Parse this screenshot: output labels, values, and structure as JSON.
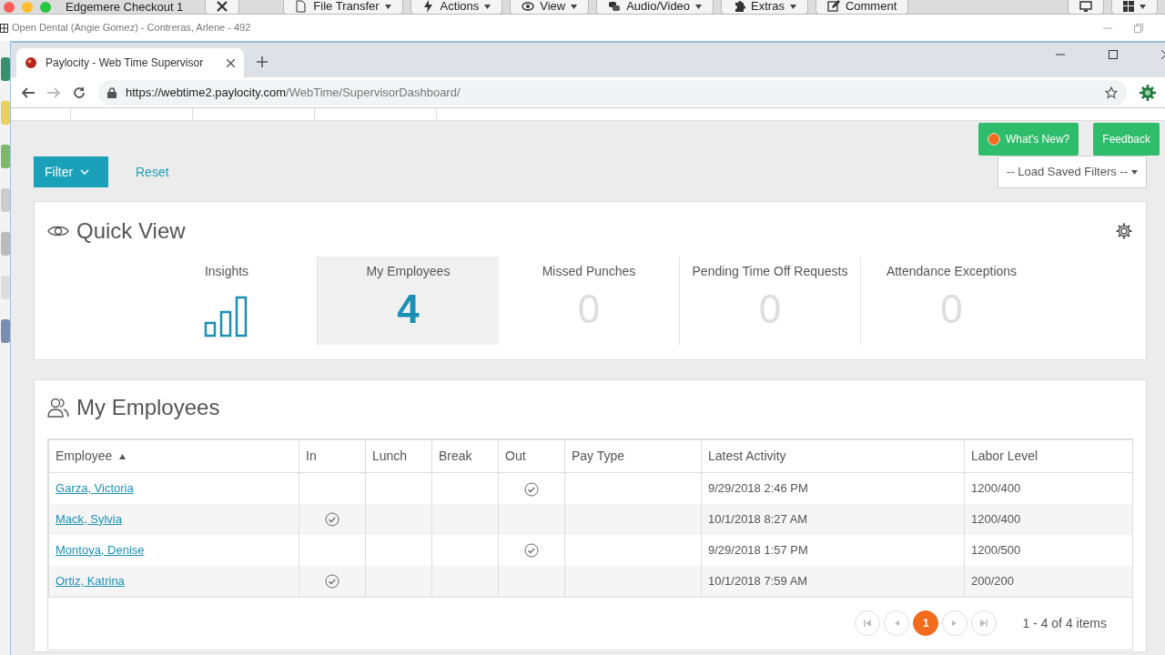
{
  "remote_session": {
    "title": "Edgemere Checkout 1",
    "toolbar": [
      {
        "label": "File Transfer",
        "dropdown": true
      },
      {
        "label": "Actions",
        "dropdown": true
      },
      {
        "label": "View",
        "dropdown": true
      },
      {
        "label": "Audio/Video",
        "dropdown": true
      },
      {
        "label": "Extras",
        "dropdown": true
      },
      {
        "label": "Comment",
        "dropdown": false
      }
    ]
  },
  "host_window": {
    "title": "Open Dental (Angie Gomez) - Contreras, Arlene - 492"
  },
  "browser": {
    "tab_title": "Paylocity - Web Time Supervisor",
    "url_host": "https://webtime2.paylocity.com",
    "url_path": "/WebTime/SupervisorDashboard/"
  },
  "header_buttons": [
    {
      "label": "What's New?",
      "kind": "news"
    },
    {
      "label": "Feedback",
      "kind": "plain"
    }
  ],
  "filter": {
    "button": "Filter",
    "reset": "Reset",
    "saved_filters": "-- Load Saved Filters --"
  },
  "quick_view": {
    "title": "Quick View",
    "tiles": [
      {
        "label": "Insights",
        "kind": "chart",
        "selected": false
      },
      {
        "label": "My Employees",
        "kind": "count",
        "value": "4",
        "selected": true
      },
      {
        "label": "Missed Punches",
        "kind": "count",
        "value": "0",
        "selected": false
      },
      {
        "label": "Pending Time Off Requests",
        "kind": "count",
        "value": "0",
        "selected": false
      },
      {
        "label": "Attendance Exceptions",
        "kind": "count",
        "value": "0",
        "selected": false
      }
    ]
  },
  "employees": {
    "title": "My Employees",
    "columns": [
      {
        "label": "Employee",
        "sorted": true
      },
      {
        "label": "In",
        "sorted": false
      },
      {
        "label": "Lunch",
        "sorted": false
      },
      {
        "label": "Break",
        "sorted": false
      },
      {
        "label": "Out",
        "sorted": false
      },
      {
        "label": "Pay Type",
        "sorted": false
      },
      {
        "label": "Latest Activity",
        "sorted": false
      },
      {
        "label": "Labor Level",
        "sorted": false
      }
    ],
    "rows": [
      {
        "employee": "Garza, Victoria",
        "in": false,
        "out": true,
        "latest_activity": "9/29/2018 2:46 PM",
        "labor_level": "1200/400"
      },
      {
        "employee": "Mack, Sylvia",
        "in": true,
        "out": false,
        "latest_activity": "10/1/2018 8:27 AM",
        "labor_level": "1200/400"
      },
      {
        "employee": "Montoya, Denise",
        "in": false,
        "out": true,
        "latest_activity": "9/29/2018 1:57 PM",
        "labor_level": "1200/500"
      },
      {
        "employee": "Ortiz, Katrina",
        "in": true,
        "out": false,
        "latest_activity": "10/1/2018 7:59 AM",
        "labor_level": "200/200"
      }
    ]
  },
  "pagination": {
    "pages": [
      {
        "label": "1",
        "selected": true
      }
    ],
    "summary": "1 - 4 of 4 items"
  }
}
